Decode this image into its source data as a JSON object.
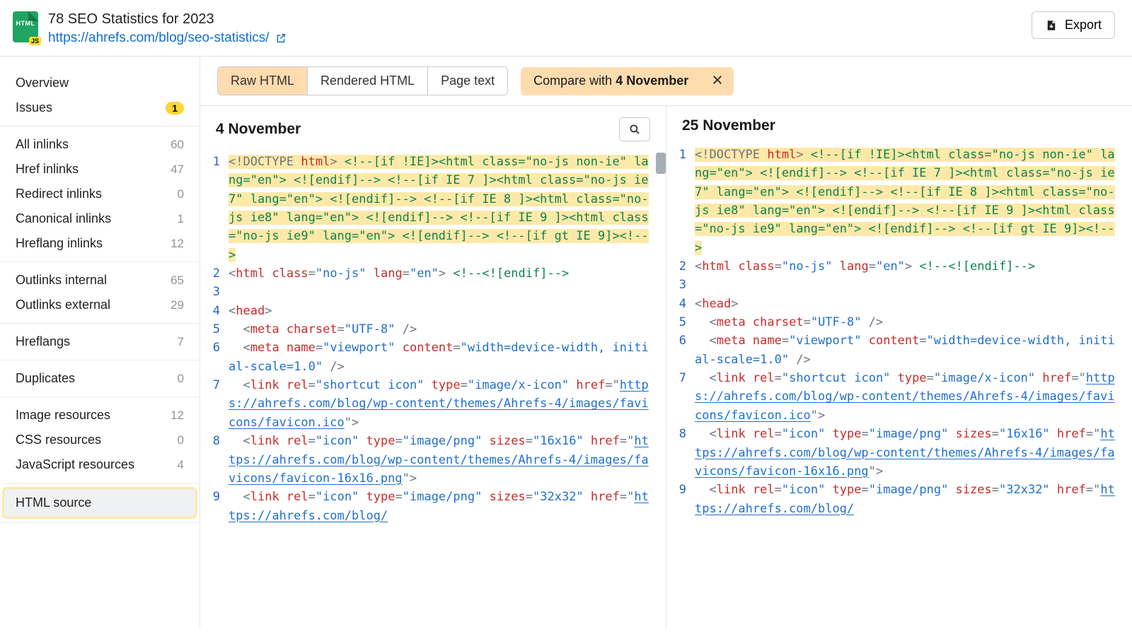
{
  "header": {
    "file_type_label": "HTML",
    "js_badge": "JS",
    "title": "78 SEO Statistics for 2023",
    "url": "https://ahrefs.com/blog/seo-statistics/",
    "export_label": "Export"
  },
  "sidebar": {
    "groups": [
      {
        "items": [
          {
            "label": "Overview",
            "count": null,
            "badge": null
          },
          {
            "label": "Issues",
            "count": null,
            "badge": "1"
          }
        ]
      },
      {
        "items": [
          {
            "label": "All inlinks",
            "count": "60"
          },
          {
            "label": "Href inlinks",
            "count": "47"
          },
          {
            "label": "Redirect inlinks",
            "count": "0"
          },
          {
            "label": "Canonical inlinks",
            "count": "1"
          },
          {
            "label": "Hreflang inlinks",
            "count": "12"
          }
        ]
      },
      {
        "items": [
          {
            "label": "Outlinks internal",
            "count": "65"
          },
          {
            "label": "Outlinks external",
            "count": "29"
          }
        ]
      },
      {
        "items": [
          {
            "label": "Hreflangs",
            "count": "7"
          }
        ]
      },
      {
        "items": [
          {
            "label": "Duplicates",
            "count": "0"
          }
        ]
      },
      {
        "items": [
          {
            "label": "Image resources",
            "count": "12"
          },
          {
            "label": "CSS resources",
            "count": "0"
          },
          {
            "label": "JavaScript resources",
            "count": "4"
          }
        ]
      },
      {
        "items": [
          {
            "label": "HTML source",
            "count": null,
            "active": true
          }
        ]
      }
    ]
  },
  "toolbar": {
    "tabs": [
      "Raw HTML",
      "Rendered HTML",
      "Page text"
    ],
    "selected_tab": 0,
    "compare_prefix": "Compare with ",
    "compare_date": "4 November"
  },
  "panes": {
    "left": {
      "title": "4 November"
    },
    "right": {
      "title": "25 November"
    }
  },
  "code_lines": [
    {
      "n": 1,
      "hl": true,
      "tokens": [
        {
          "c": "gray",
          "t": "<!DOCTYPE "
        },
        {
          "c": "red",
          "t": "html"
        },
        {
          "c": "gray",
          "t": "> "
        },
        {
          "c": "green",
          "t": "<!--[if !IE]><html class=\"no-js non-ie\" lang=\"en\"> <![endif]--> <!--[if IE 7 ]><html class=\"no-js ie7\" lang=\"en\"> <![endif]--> <!--[if IE 8 ]><html class=\"no-js ie8\" lang=\"en\"> <![endif]--> <!--[if IE 9 ]><html class=\"no-js ie9\" lang=\"en\"> <![endif]--> <!--[if gt IE 9]><!-->"
        }
      ]
    },
    {
      "n": 2,
      "tokens": [
        {
          "c": "gray",
          "t": "<"
        },
        {
          "c": "red",
          "t": "html "
        },
        {
          "c": "red",
          "t": "class"
        },
        {
          "c": "gray",
          "t": "="
        },
        {
          "c": "blue",
          "t": "\"no-js\" "
        },
        {
          "c": "red",
          "t": "lang"
        },
        {
          "c": "gray",
          "t": "="
        },
        {
          "c": "blue",
          "t": "\"en\""
        },
        {
          "c": "gray",
          "t": "> "
        },
        {
          "c": "green",
          "t": "<!--<![endif]-->"
        }
      ]
    },
    {
      "n": 3,
      "tokens": []
    },
    {
      "n": 4,
      "tokens": [
        {
          "c": "gray",
          "t": "<"
        },
        {
          "c": "red",
          "t": "head"
        },
        {
          "c": "gray",
          "t": ">"
        }
      ]
    },
    {
      "n": 5,
      "tokens": [
        {
          "c": "gray",
          "t": "  <"
        },
        {
          "c": "red",
          "t": "meta "
        },
        {
          "c": "red",
          "t": "charset"
        },
        {
          "c": "gray",
          "t": "="
        },
        {
          "c": "blue",
          "t": "\"UTF-8\""
        },
        {
          "c": "gray",
          "t": " />"
        }
      ]
    },
    {
      "n": 6,
      "tokens": [
        {
          "c": "gray",
          "t": "  <"
        },
        {
          "c": "red",
          "t": "meta "
        },
        {
          "c": "red",
          "t": "name"
        },
        {
          "c": "gray",
          "t": "="
        },
        {
          "c": "blue",
          "t": "\"viewport\" "
        },
        {
          "c": "red",
          "t": "content"
        },
        {
          "c": "gray",
          "t": "="
        },
        {
          "c": "blue",
          "t": "\"width=device-width, initial-scale=1.0\""
        },
        {
          "c": "gray",
          "t": " />"
        }
      ]
    },
    {
      "n": 7,
      "tokens": [
        {
          "c": "gray",
          "t": "  <"
        },
        {
          "c": "red",
          "t": "link "
        },
        {
          "c": "red",
          "t": "rel"
        },
        {
          "c": "gray",
          "t": "="
        },
        {
          "c": "blue",
          "t": "\"shortcut icon\" "
        },
        {
          "c": "red",
          "t": "type"
        },
        {
          "c": "gray",
          "t": "="
        },
        {
          "c": "blue",
          "t": "\"image/x-icon\" "
        },
        {
          "c": "red",
          "t": "href"
        },
        {
          "c": "gray",
          "t": "=\""
        },
        {
          "c": "link",
          "t": "https://ahrefs.com/blog/wp-content/themes/Ahrefs-4/images/favicons/favicon.ico"
        },
        {
          "c": "gray",
          "t": "\">"
        }
      ]
    },
    {
      "n": 8,
      "tokens": [
        {
          "c": "gray",
          "t": "  <"
        },
        {
          "c": "red",
          "t": "link "
        },
        {
          "c": "red",
          "t": "rel"
        },
        {
          "c": "gray",
          "t": "="
        },
        {
          "c": "blue",
          "t": "\"icon\" "
        },
        {
          "c": "red",
          "t": "type"
        },
        {
          "c": "gray",
          "t": "="
        },
        {
          "c": "blue",
          "t": "\"image/png\" "
        },
        {
          "c": "red",
          "t": "sizes"
        },
        {
          "c": "gray",
          "t": "="
        },
        {
          "c": "blue",
          "t": "\"16x16\" "
        },
        {
          "c": "red",
          "t": "href"
        },
        {
          "c": "gray",
          "t": "=\""
        },
        {
          "c": "link",
          "t": "https://ahrefs.com/blog/wp-content/themes/Ahrefs-4/images/favicons/favicon-16x16.png"
        },
        {
          "c": "gray",
          "t": "\">"
        }
      ]
    },
    {
      "n": 9,
      "tokens": [
        {
          "c": "gray",
          "t": "  <"
        },
        {
          "c": "red",
          "t": "link "
        },
        {
          "c": "red",
          "t": "rel"
        },
        {
          "c": "gray",
          "t": "="
        },
        {
          "c": "blue",
          "t": "\"icon\" "
        },
        {
          "c": "red",
          "t": "type"
        },
        {
          "c": "gray",
          "t": "="
        },
        {
          "c": "blue",
          "t": "\"image/png\" "
        },
        {
          "c": "red",
          "t": "sizes"
        },
        {
          "c": "gray",
          "t": "="
        },
        {
          "c": "blue",
          "t": "\"32x32\" "
        },
        {
          "c": "red",
          "t": "href"
        },
        {
          "c": "gray",
          "t": "=\""
        },
        {
          "c": "link",
          "t": "https://ahrefs.com/blog/"
        }
      ]
    }
  ]
}
